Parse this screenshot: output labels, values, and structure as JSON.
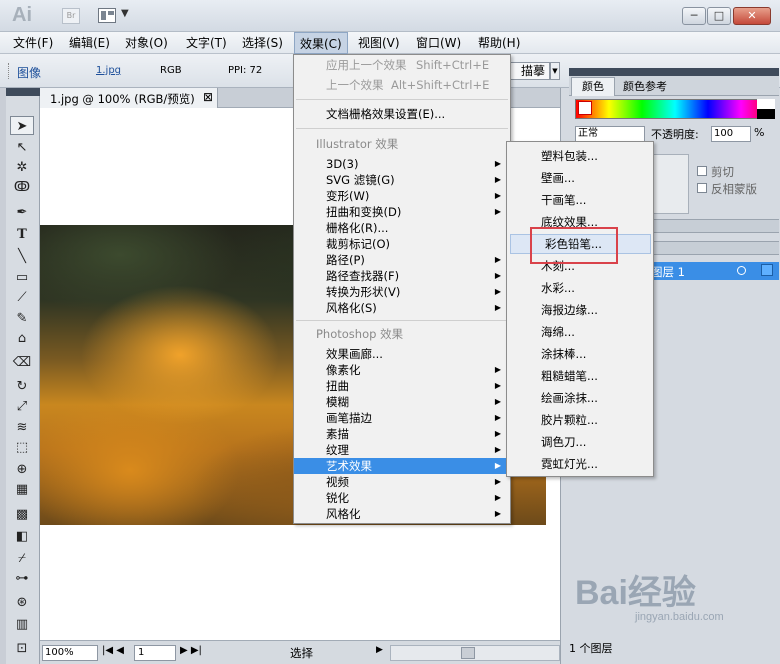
{
  "app": {
    "logo": "Ai",
    "br": "Br"
  },
  "window": {
    "minimize": "─",
    "restore": "□",
    "close": "✕"
  },
  "menubar": [
    {
      "label": "文件(F)"
    },
    {
      "label": "编辑(E)"
    },
    {
      "label": "对象(O)"
    },
    {
      "label": "文字(T)"
    },
    {
      "label": "选择(S)"
    },
    {
      "label": "效果(C)"
    },
    {
      "label": "视图(V)"
    },
    {
      "label": "窗口(W)"
    },
    {
      "label": "帮助(H)"
    }
  ],
  "controlbar": {
    "image_label": "图像",
    "file_link": "1.jpg",
    "mode": "RGB",
    "ppi": "PPI: 72",
    "trace": "描摹"
  },
  "document": {
    "tab_title": "1.jpg @ 100% (RGB/预览)",
    "close": "⊠"
  },
  "status": {
    "zoom": "100%",
    "page": "1",
    "tool": "选择"
  },
  "effect_menu": {
    "apply_last": {
      "label": "应用上一个效果",
      "shortcut": "Shift+Ctrl+E"
    },
    "last": {
      "label": "上一个效果",
      "shortcut": "Alt+Shift+Ctrl+E"
    },
    "raster_settings": "文档栅格效果设置(E)...",
    "illustrator_header": "Illustrator 效果",
    "illustrator_items": [
      "3D(3)",
      "SVG 滤镜(G)",
      "变形(W)",
      "扭曲和变换(D)",
      "栅格化(R)...",
      "裁剪标记(O)",
      "路径(P)",
      "路径查找器(F)",
      "转换为形状(V)",
      "风格化(S)"
    ],
    "photoshop_header": "Photoshop 效果",
    "photoshop_items": [
      "效果画廊...",
      "像素化",
      "扭曲",
      "模糊",
      "画笔描边",
      "素描",
      "纹理",
      "艺术效果",
      "视频",
      "锐化",
      "风格化"
    ]
  },
  "artistic_submenu": [
    "塑料包装...",
    "壁画...",
    "干画笔...",
    "底纹效果...",
    "彩色铅笔...",
    "木刻...",
    "水彩...",
    "海报边缘...",
    "海绵...",
    "涂抹棒...",
    "粗糙蜡笔...",
    "绘画涂抹...",
    "胶片颗粒...",
    "调色刀...",
    "霓虹灯光..."
  ],
  "panels": {
    "color_tab": "颜色",
    "color_guide_tab": "颜色参考",
    "blend_mode": "正常",
    "opacity_label": "不透明度:",
    "opacity_value": "100",
    "opacity_unit": "%",
    "clip": "剪切",
    "invert_mask": "反相蒙版",
    "layer_name": "图层 1",
    "layer_count": "1 个图层"
  },
  "watermark": {
    "text": "Bai经验",
    "url": "jingyan.baidu.com"
  },
  "colors": {
    "highlight": "#3a8ee6",
    "annotation_box": "#d9424a"
  }
}
